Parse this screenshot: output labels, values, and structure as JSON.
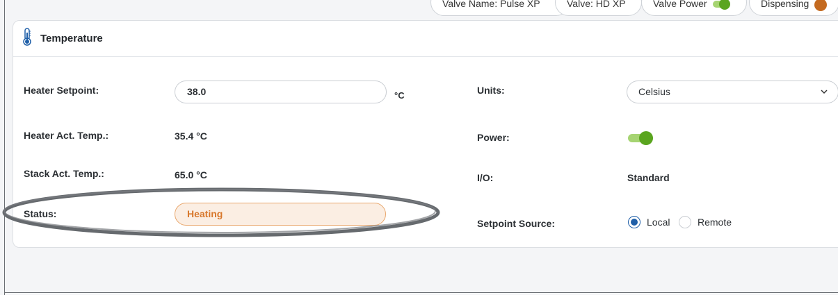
{
  "top_chips": [
    {
      "label": "Valve Name: Pulse XP",
      "indicator": "none"
    },
    {
      "label": "Valve: HD XP",
      "indicator": "none"
    },
    {
      "label": "Valve Power",
      "indicator": "toggle-on"
    },
    {
      "label": "Dispensing",
      "indicator": "status-dot"
    }
  ],
  "card": {
    "title": "Temperature",
    "icon": "thermometer-icon"
  },
  "fields": {
    "heater_setpoint": {
      "label": "Heater Setpoint:",
      "value": "38.0",
      "unit": "°C"
    },
    "heater_act_temp": {
      "label": "Heater Act. Temp.:",
      "value": "35.4 °C"
    },
    "stack_act_temp": {
      "label": "Stack Act. Temp.:",
      "value": "65.0 °C"
    },
    "status": {
      "label": "Status:",
      "value": "Heating"
    },
    "units": {
      "label": "Units:",
      "value": "Celsius"
    },
    "power": {
      "label": "Power:",
      "state": "on"
    },
    "io": {
      "label": "I/O:",
      "value": "Standard"
    },
    "setpoint_source": {
      "label": "Setpoint Source:",
      "options": [
        "Local",
        "Remote"
      ],
      "selected": "Local"
    }
  },
  "colors": {
    "accent_green": "#5aa51f",
    "status_orange": "#d8782c",
    "radio_blue": "#1f5fa8",
    "annotation_gray": "#666a6e"
  }
}
